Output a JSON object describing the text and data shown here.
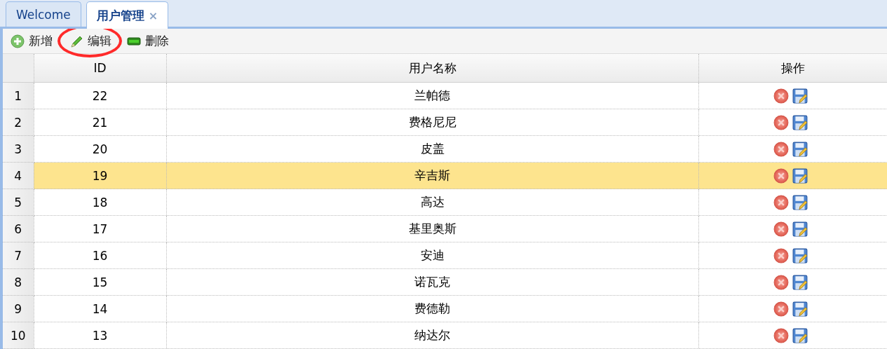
{
  "tabs": [
    {
      "label": "Welcome",
      "selected": false
    },
    {
      "label": "用户管理",
      "selected": true,
      "close": "×"
    }
  ],
  "toolbar": [
    {
      "label": "新增",
      "kind": "add",
      "circled": false
    },
    {
      "label": "编辑",
      "kind": "edit",
      "circled": true
    },
    {
      "label": "删除",
      "kind": "remove",
      "circled": false
    }
  ],
  "table": {
    "columns": [
      "ID",
      "用户名称",
      "操作"
    ],
    "rows": [
      {
        "number": "1",
        "id": "22",
        "name": "兰帕德",
        "selected": false
      },
      {
        "number": "2",
        "id": "21",
        "name": "费格尼尼",
        "selected": false
      },
      {
        "number": "3",
        "id": "20",
        "name": "皮盖",
        "selected": false
      },
      {
        "number": "4",
        "id": "19",
        "name": "辛吉斯",
        "selected": true
      },
      {
        "number": "5",
        "id": "18",
        "name": "高达",
        "selected": false
      },
      {
        "number": "6",
        "id": "17",
        "name": "基里奥斯",
        "selected": false
      },
      {
        "number": "7",
        "id": "16",
        "name": "安迪",
        "selected": false
      },
      {
        "number": "8",
        "id": "15",
        "name": "诺瓦克",
        "selected": false
      },
      {
        "number": "9",
        "id": "14",
        "name": "费德勒",
        "selected": false
      },
      {
        "number": "10",
        "id": "13",
        "name": "纳达尔",
        "selected": false
      }
    ]
  }
}
